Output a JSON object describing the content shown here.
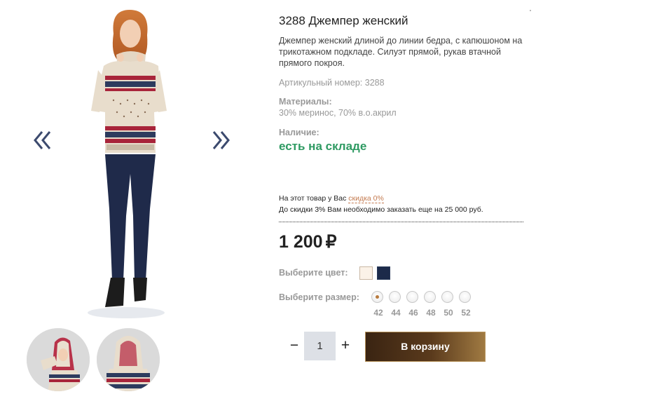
{
  "colors": {
    "accent_green": "#2e9a62",
    "link_brown": "#c47b50",
    "cart_button": "#4a2e16",
    "swatch_cream": "#fbf2e8",
    "swatch_navy": "#1c2a4a"
  },
  "gallery": {
    "prev_icon": "chevron-double-left-icon",
    "next_icon": "chevron-double-right-icon",
    "main_photo": "product-photo-woman-sweater",
    "thumbnails": [
      "thumbnail-hood-side",
      "thumbnail-hood-back"
    ]
  },
  "product": {
    "title": "3288 Джемпер женский",
    "description": "Джемпер женский длиной до линии бедра, с капюшоном на трикотажном подкладе. Силуэт прямой, рукав втачной прямого покроя.",
    "sku": "Артикульный номер: 3288",
    "materials_label": "Материалы:",
    "materials_value": "30% меринос, 70% в.о.акрил",
    "availability_label": "Наличие:",
    "availability_value": "есть на складе"
  },
  "discount": {
    "line1_prefix": "На этот товар у Вас ",
    "link": "скидка 0%",
    "line2": "До скидки 3% Вам необходимо заказать еще на 25 000 руб."
  },
  "price": {
    "amount": "1 200",
    "currency": "₽"
  },
  "color": {
    "label": "Выберите цвет:",
    "options": [
      "cream",
      "navy"
    ]
  },
  "size": {
    "label": "Выберите размер:",
    "options": [
      "42",
      "44",
      "46",
      "48",
      "50",
      "52"
    ],
    "selected": "42"
  },
  "cart": {
    "minus": "−",
    "quantity": "1",
    "plus": "+",
    "button": "В корзину"
  }
}
